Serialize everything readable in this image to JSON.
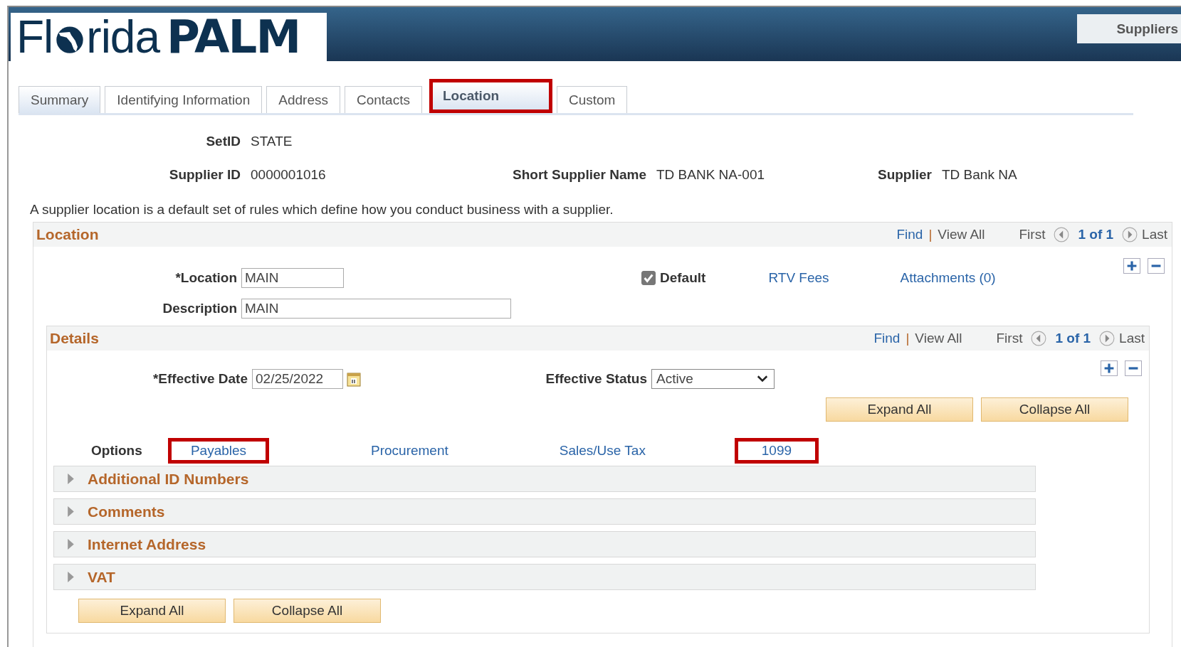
{
  "header": {
    "logo": {
      "part_1": "Fl",
      "part_2": "rida",
      "part_3": "PALM"
    },
    "button": "Suppliers"
  },
  "tabs": [
    {
      "label": "Summary",
      "selected": false,
      "highlighted": false
    },
    {
      "label": "Identifying Information",
      "selected": false,
      "highlighted": false
    },
    {
      "label": "Address",
      "selected": false,
      "highlighted": false
    },
    {
      "label": "Contacts",
      "selected": false,
      "highlighted": false
    },
    {
      "label": "Location",
      "selected": true,
      "highlighted": true
    },
    {
      "label": "Custom",
      "selected": false,
      "highlighted": false
    }
  ],
  "fields": {
    "setid": {
      "label": "SetID",
      "value": "STATE"
    },
    "supplier_id": {
      "label": "Supplier ID",
      "value": "0000001016"
    },
    "short_supplier_name": {
      "label": "Short Supplier Name",
      "value": "TD BANK NA-001"
    },
    "supplier": {
      "label": "Supplier",
      "value": "TD Bank NA"
    }
  },
  "description": "A supplier location is a default set of rules which define how you conduct business with a supplier.",
  "location": {
    "title": "Location",
    "nav": {
      "find": "Find",
      "separator": "|",
      "view_all": "View All",
      "first": "First",
      "count": "1 of 1",
      "last": "Last"
    },
    "location_field": {
      "label": "*Location",
      "value": "MAIN"
    },
    "default": {
      "label": "Default",
      "checked": true
    },
    "links": [
      "RTV Fees",
      "Attachments (0)"
    ],
    "description_field": {
      "label": "Description",
      "value": "MAIN"
    },
    "details": {
      "title": "Details",
      "nav": {
        "find": "Find",
        "separator": "|",
        "view_all": "View All",
        "first": "First",
        "count": "1 of 1",
        "last": "Last"
      },
      "effective_date": {
        "label": "*Effective Date",
        "value": "02/25/2022"
      },
      "effective_status": {
        "label": "Effective Status",
        "value": "Active"
      },
      "buttons": [
        "Expand All",
        "Collapse All"
      ],
      "options": {
        "label": "Options",
        "links": [
          {
            "label": "Payables",
            "highlighted": true
          },
          {
            "label": "Procurement",
            "highlighted": false
          },
          {
            "label": "Sales/Use Tax",
            "highlighted": false
          },
          {
            "label": "1099",
            "highlighted": true
          }
        ]
      },
      "sections": [
        {
          "title": "Additional ID Numbers",
          "expanded": false
        },
        {
          "title": "Comments",
          "expanded": false
        },
        {
          "title": "Internet Address",
          "expanded": false
        },
        {
          "title": "VAT",
          "expanded": false
        }
      ],
      "bottom_buttons": [
        "Expand All",
        "Collapse All"
      ]
    }
  }
}
